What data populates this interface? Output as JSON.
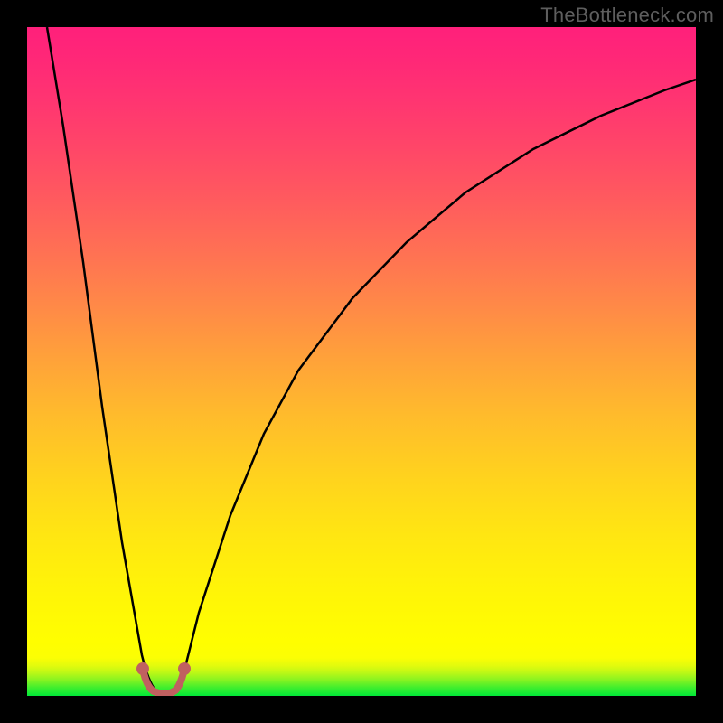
{
  "watermark": "TheBottleneck.com",
  "chart_data": {
    "type": "line",
    "title": "",
    "xlabel": "",
    "ylabel": "",
    "xlim": [
      0,
      100
    ],
    "ylim": [
      0,
      100
    ],
    "gradient_colors": {
      "top": "#ff207b",
      "bottom": "#00e838"
    },
    "series": [
      {
        "name": "bottleneck-curve",
        "type": "line",
        "x": [
          3,
          5,
          8,
          11,
          14,
          17,
          18.6,
          20.5,
          22,
          25,
          30,
          35,
          40,
          48,
          56,
          65,
          75,
          85,
          95,
          100
        ],
        "y": [
          100,
          84,
          63,
          42,
          22,
          6,
          0,
          0,
          2,
          12,
          27,
          39,
          48,
          59,
          68,
          75,
          82,
          87,
          90.5,
          92
        ]
      },
      {
        "name": "marker-left",
        "type": "scatter",
        "x": [
          17.2
        ],
        "y": [
          4
        ],
        "color": "#c06060"
      },
      {
        "name": "marker-right",
        "type": "scatter",
        "x": [
          22.3
        ],
        "y": [
          4
        ],
        "color": "#c06060"
      },
      {
        "name": "bottom-path",
        "type": "line",
        "x": [
          17.2,
          18,
          19,
          20,
          21,
          22.3
        ],
        "y": [
          4,
          1.2,
          0.3,
          0.3,
          1.2,
          4
        ],
        "color": "#c06060",
        "width": 7
      }
    ]
  }
}
